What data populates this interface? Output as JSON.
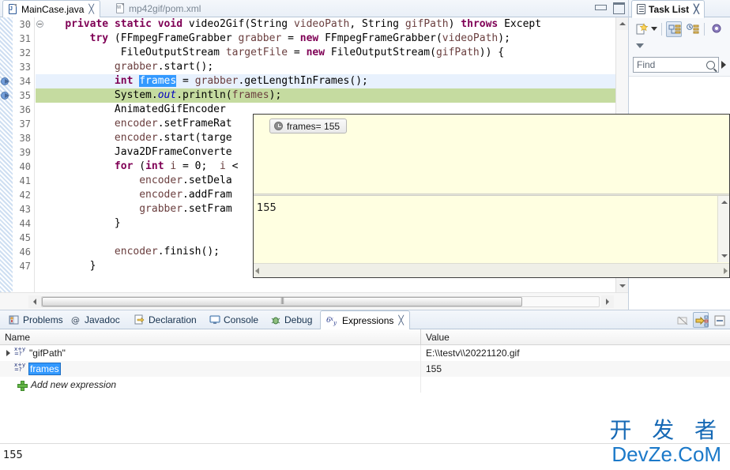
{
  "editor": {
    "tabs": [
      {
        "label": "MainCase.java",
        "icon": "java-file-icon",
        "letter": "J",
        "active": true,
        "close": "╳"
      },
      {
        "label": "mp42gif/pom.xml",
        "icon": "xml-file-icon",
        "letter": "M",
        "active": false,
        "close": ""
      }
    ],
    "window_buttons": {
      "minimize": "minimize-button",
      "maximize": "maximize-button"
    },
    "first_line_number": 30,
    "lines": [
      {
        "n": 30,
        "fold": true,
        "breakpoint": false,
        "state": "normal",
        "text": "    private static void video2Gif(String videoPath, String gifPath) throws Except"
      },
      {
        "n": 31,
        "fold": false,
        "breakpoint": false,
        "state": "normal",
        "text": "        try (FFmpegFrameGrabber grabber = new FFmpegFrameGrabber(videoPath);"
      },
      {
        "n": 32,
        "fold": false,
        "breakpoint": false,
        "state": "normal",
        "text": "             FileOutputStream targetFile = new FileOutputStream(gifPath)) {"
      },
      {
        "n": 33,
        "fold": false,
        "breakpoint": false,
        "state": "normal",
        "text": "            grabber.start();"
      },
      {
        "n": 34,
        "fold": false,
        "breakpoint": true,
        "state": "selected",
        "text": "            int frames = grabber.getLengthInFrames();"
      },
      {
        "n": 35,
        "fold": false,
        "breakpoint": true,
        "state": "executing",
        "text": "            System.out.println(frames);"
      },
      {
        "n": 36,
        "fold": false,
        "breakpoint": false,
        "state": "normal",
        "text": "            AnimatedGifEncoder"
      },
      {
        "n": 37,
        "fold": false,
        "breakpoint": false,
        "state": "normal",
        "text": "            encoder.setFrameRat"
      },
      {
        "n": 38,
        "fold": false,
        "breakpoint": false,
        "state": "normal",
        "text": "            encoder.start(targe"
      },
      {
        "n": 39,
        "fold": false,
        "breakpoint": false,
        "state": "normal",
        "text": "            Java2DFrameConverte"
      },
      {
        "n": 40,
        "fold": false,
        "breakpoint": false,
        "state": "normal",
        "text": "            for (int i = 0;  i <"
      },
      {
        "n": 41,
        "fold": false,
        "breakpoint": false,
        "state": "normal",
        "text": "                encoder.setDela"
      },
      {
        "n": 42,
        "fold": false,
        "breakpoint": false,
        "state": "normal",
        "text": "                encoder.addFram"
      },
      {
        "n": 43,
        "fold": false,
        "breakpoint": false,
        "state": "normal",
        "text": "                grabber.setFram"
      },
      {
        "n": 44,
        "fold": false,
        "breakpoint": false,
        "state": "normal",
        "text": "            }"
      },
      {
        "n": 45,
        "fold": false,
        "breakpoint": false,
        "state": "normal",
        "text": ""
      },
      {
        "n": 46,
        "fold": false,
        "breakpoint": false,
        "state": "normal",
        "text": "            encoder.finish();"
      },
      {
        "n": 47,
        "fold": false,
        "breakpoint": false,
        "state": "normal",
        "text": "        }"
      }
    ]
  },
  "popup": {
    "tooltip_label": "frames= 155",
    "tooltip_icon": "clock-icon",
    "value_text": "155"
  },
  "task_list": {
    "tab_label": "Task List",
    "tab_close": "╳",
    "toolbar": {
      "new_task": "new-task-icon",
      "dropdown": "chevron-down-icon",
      "categorized": "categorized-view-icon",
      "scheduled": "scheduled-view-icon",
      "focus": "focus-icon"
    },
    "collapse_icon": "chevron-down-outline-icon",
    "find": {
      "placeholder": "Find",
      "value": "",
      "icon": "search-icon"
    },
    "expand_icon": "play-right-icon"
  },
  "bottom_view": {
    "tabs": [
      {
        "label": "Problems",
        "icon": "problems-icon",
        "active": false
      },
      {
        "label": "Javadoc",
        "icon": "javadoc-icon",
        "active": false
      },
      {
        "label": "Declaration",
        "icon": "declaration-icon",
        "active": false
      },
      {
        "label": "Console",
        "icon": "console-icon",
        "active": false
      },
      {
        "label": "Debug",
        "icon": "debug-icon",
        "active": false
      },
      {
        "label": "Expressions",
        "icon": "expressions-icon",
        "active": true,
        "close": "╳"
      }
    ],
    "toolbar": [
      {
        "name": "remove-all-expressions-icon",
        "pressed": false
      },
      {
        "name": "show-logical-structure-icon",
        "pressed": true
      },
      {
        "name": "view-menu-icon",
        "pressed": false
      }
    ],
    "table": {
      "columns": [
        "Name",
        "Value"
      ],
      "rows": [
        {
          "name": "\"gifPath\"",
          "value": "E:\\\\testv\\\\20221120.gif",
          "expandable": true,
          "editing": false
        },
        {
          "name": "frames",
          "value": "155",
          "expandable": false,
          "editing": true
        }
      ],
      "add_row_label": "Add new expression",
      "add_row_icon": "plus-icon"
    }
  },
  "status": {
    "text": "155"
  },
  "watermark": {
    "cn": "开 发 者",
    "en": "DevZe.CoM"
  }
}
